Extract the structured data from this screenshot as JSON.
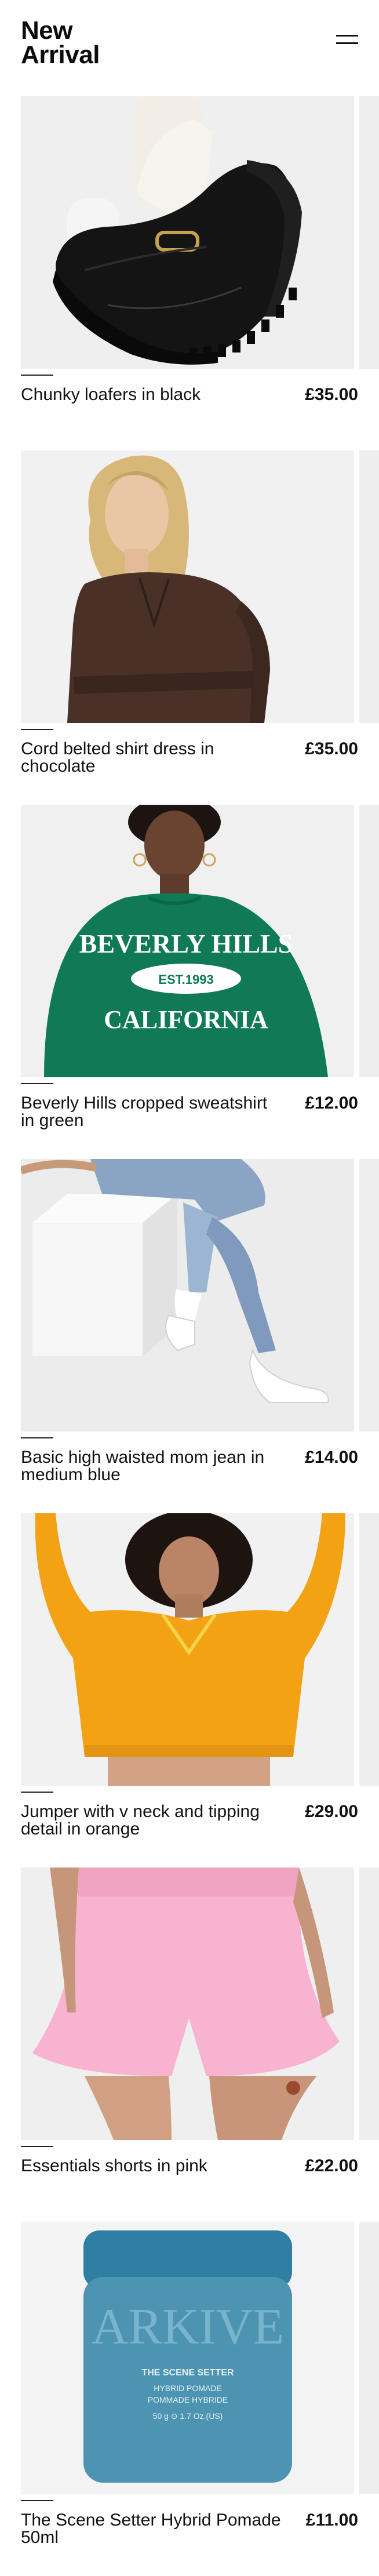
{
  "header": {
    "title_line1": "New",
    "title_line2": "Arrival",
    "menu_icon": "hamburger-menu-icon"
  },
  "products": [
    {
      "name": "Chunky loafers in black",
      "price": "£35.00",
      "image": "black-loafers-photo"
    },
    {
      "name": "Cord belted shirt dress in chocolate",
      "price": "£35.00",
      "image": "chocolate-shirt-dress-photo"
    },
    {
      "name": "Beverly Hills cropped sweatshirt in green",
      "price": "£12.00",
      "image": "green-sweatshirt-photo",
      "print": {
        "line1": "BEVERLY HILLS",
        "line2": "EST.1993",
        "line3": "CALIFORNIA"
      }
    },
    {
      "name": "Basic high waisted mom jean in medium blue",
      "price": "£14.00",
      "image": "mom-jeans-photo"
    },
    {
      "name": "Jumper with v neck and tipping detail in orange",
      "price": "£29.00",
      "image": "orange-jumper-photo"
    },
    {
      "name": "Essentials shorts in pink",
      "price": "£22.00",
      "image": "pink-shorts-photo"
    },
    {
      "name": "The Scene Setter Hybrid Pomade 50ml",
      "price": "£11.00",
      "image": "pomade-jar-photo",
      "print": {
        "brand": "ARKIVE",
        "line1": "THE SCENE SETTER",
        "line2": "HYBRID POMADE",
        "line3": "POMMADE HYBRIDE",
        "line4": "50 g ⊙ 1.7 Oz.(US)"
      }
    }
  ],
  "colors": {
    "text": "#111111",
    "background": "#ffffff",
    "image_placeholder": "#eeeeee"
  }
}
